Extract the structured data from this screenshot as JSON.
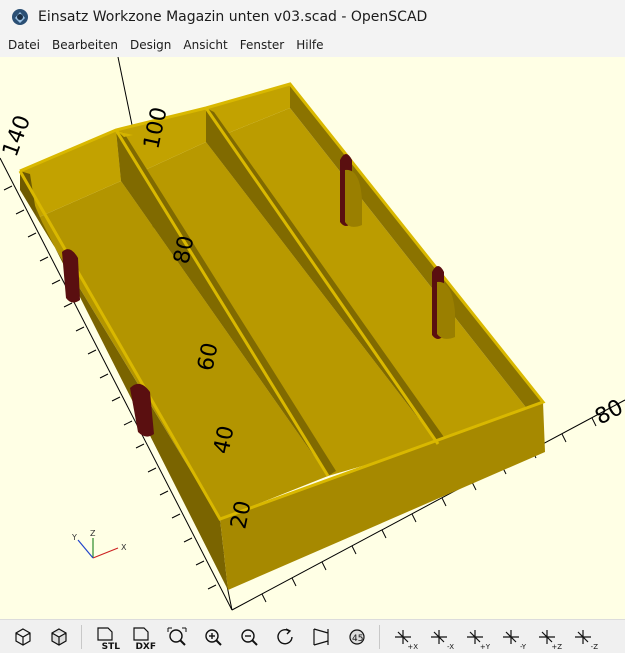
{
  "window": {
    "title": "Einsatz Workzone Magazin unten v03.scad - OpenSCAD"
  },
  "menu": [
    "Datei",
    "Bearbeiten",
    "Design",
    "Ansicht",
    "Fenster",
    "Hilfe"
  ],
  "viewport": {
    "axis_labels": [
      "140",
      "100",
      "80",
      "60",
      "40",
      "20",
      "80"
    ],
    "colors": {
      "background": "#ffffe5",
      "model_top": "#ccaa00",
      "model_wall_light": "#a88a00",
      "model_wall_dark": "#6e5a00",
      "model_floor": "#b89900",
      "cutout": "#5a0f10"
    }
  },
  "toolbar": {
    "buttons": [
      {
        "name": "view-all-icon",
        "label": ""
      },
      {
        "name": "render-icon",
        "label": ""
      },
      {
        "name": "export-stl-icon",
        "label": "STL"
      },
      {
        "name": "export-dxf-icon",
        "label": "DXF"
      },
      {
        "name": "zoom-all-icon",
        "label": ""
      },
      {
        "name": "zoom-in-icon",
        "label": ""
      },
      {
        "name": "zoom-out-icon",
        "label": ""
      },
      {
        "name": "reset-view-icon",
        "label": ""
      },
      {
        "name": "perspective-icon",
        "label": ""
      },
      {
        "name": "orthogonal-icon",
        "label": ""
      },
      {
        "name": "view-right-icon",
        "label": "+X"
      },
      {
        "name": "view-left-icon",
        "label": "-X"
      },
      {
        "name": "view-back-icon",
        "label": "+Y"
      },
      {
        "name": "view-front-icon",
        "label": "-Y"
      },
      {
        "name": "view-top-icon",
        "label": "+Z"
      },
      {
        "name": "view-bottom-icon",
        "label": "-Z"
      }
    ]
  }
}
